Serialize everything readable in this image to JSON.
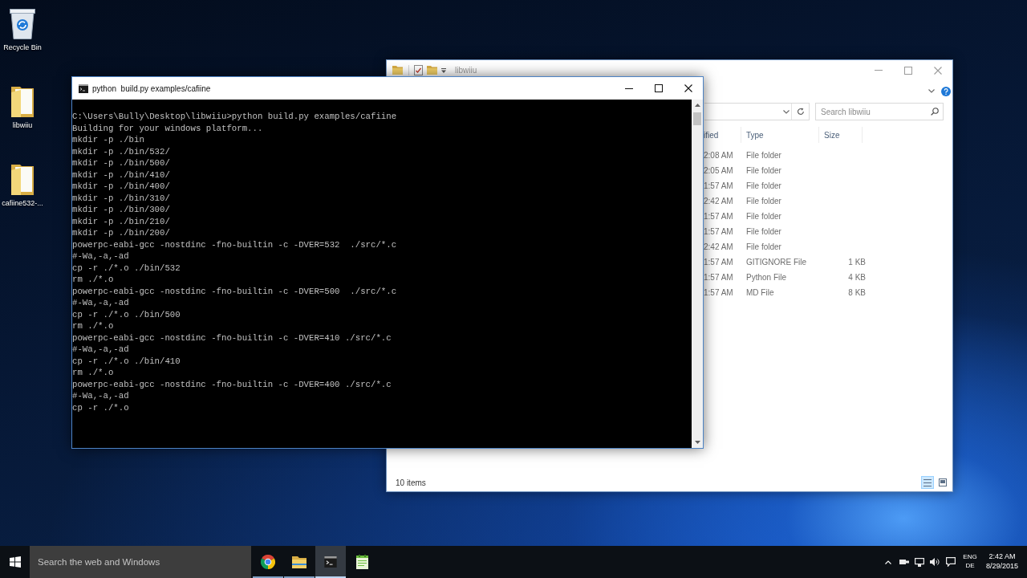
{
  "desktop": {
    "icons": [
      {
        "kind": "recycle-bin",
        "label": "Recycle Bin"
      },
      {
        "kind": "folder",
        "label": "libwiiu"
      },
      {
        "kind": "folder",
        "label": "cafiine532-..."
      }
    ]
  },
  "explorer": {
    "title": "libwiiu",
    "search": {
      "placeholder": "Search libwiiu"
    },
    "columns": [
      "ified",
      "Type",
      "Size"
    ],
    "rows": [
      {
        "cells": [
          "2:08 AM",
          "File folder"
        ]
      },
      {
        "cells": [
          "2:05 AM",
          "File folder"
        ]
      },
      {
        "cells": [
          "1:57 AM",
          "File folder"
        ]
      },
      {
        "cells": [
          "2:42 AM",
          "File folder"
        ]
      },
      {
        "cells": [
          "1:57 AM",
          "File folder"
        ]
      },
      {
        "cells": [
          "1:57 AM",
          "File folder"
        ]
      },
      {
        "cells": [
          "2:42 AM",
          "File folder"
        ]
      },
      {
        "cells": [
          "1:57 AM",
          "GITIGNORE File",
          "1 KB"
        ]
      },
      {
        "cells": [
          "1:57 AM",
          "Python File",
          "4 KB"
        ]
      },
      {
        "cells": [
          "1:57 AM",
          "MD File",
          "8 KB"
        ]
      }
    ],
    "status": "10 items",
    "views": [
      {
        "kind": "details",
        "selected": true
      },
      {
        "kind": "large-icons",
        "selected": false
      }
    ]
  },
  "console": {
    "title": "python  build.py examples/cafiine",
    "lines": [
      "C:\\Users\\Bully\\Desktop\\libwiiu>python build.py examples/cafiine",
      "Building for your windows platform...",
      "mkdir -p ./bin",
      "mkdir -p ./bin/532/",
      "mkdir -p ./bin/500/",
      "mkdir -p ./bin/410/",
      "mkdir -p ./bin/400/",
      "mkdir -p ./bin/310/",
      "mkdir -p ./bin/300/",
      "mkdir -p ./bin/210/",
      "mkdir -p ./bin/200/",
      "powerpc-eabi-gcc -nostdinc -fno-builtin -c -DVER=532  ./src/*.c",
      "#-Wa,-a,-ad",
      "cp -r ./*.o ./bin/532",
      "rm ./*.o",
      "powerpc-eabi-gcc -nostdinc -fno-builtin -c -DVER=500  ./src/*.c",
      "#-Wa,-a,-ad",
      "cp -r ./*.o ./bin/500",
      "rm ./*.o",
      "powerpc-eabi-gcc -nostdinc -fno-builtin -c -DVER=410 ./src/*.c",
      "#-Wa,-a,-ad",
      "cp -r ./*.o ./bin/410",
      "rm ./*.o",
      "powerpc-eabi-gcc -nostdinc -fno-builtin -c -DVER=400 ./src/*.c",
      "#-Wa,-a,-ad",
      "cp -r ./*.o"
    ]
  },
  "taskbar": {
    "search": {
      "placeholder": "Search the web and Windows"
    },
    "apps": [
      {
        "kind": "browser",
        "running": true,
        "selected": false
      },
      {
        "kind": "folder",
        "running": true,
        "selected": false
      },
      {
        "kind": "terminal",
        "running": true,
        "selected": true
      },
      {
        "kind": "notepad",
        "running": false,
        "selected": false
      }
    ],
    "tray": {
      "language": "ENG",
      "layout": "DE",
      "time": "2:42 AM",
      "date": "8/29/2015"
    }
  }
}
